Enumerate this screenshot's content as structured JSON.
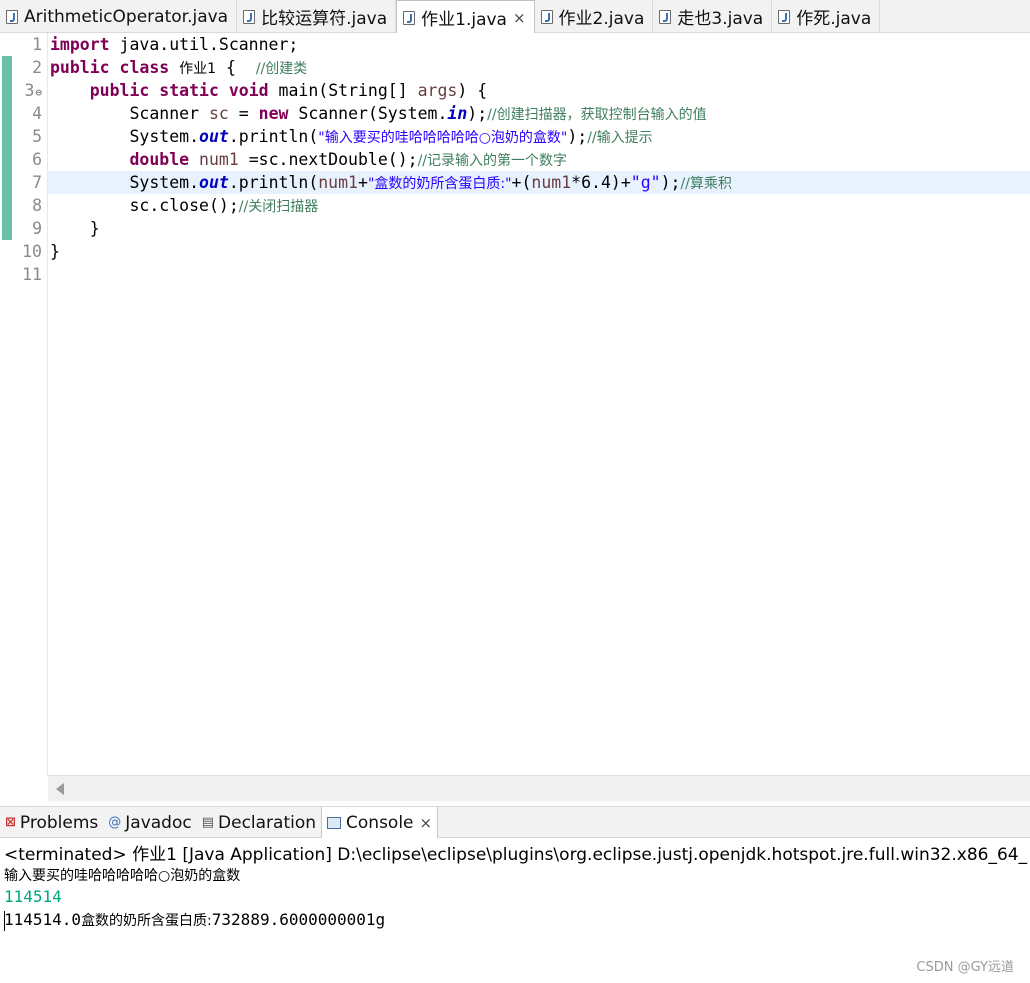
{
  "editor_tabs": [
    {
      "label": "ArithmeticOperator.java",
      "active": false
    },
    {
      "label": "比较运算符.java",
      "active": false
    },
    {
      "label": "作业1.java",
      "active": true
    },
    {
      "label": "作业2.java",
      "active": false
    },
    {
      "label": "走也3.java",
      "active": false
    },
    {
      "label": "作死.java",
      "active": false
    }
  ],
  "close_glyph": "×",
  "line_numbers": [
    "1",
    "2",
    "3",
    "4",
    "5",
    "6",
    "7",
    "8",
    "9",
    "10",
    "11"
  ],
  "code": {
    "l1": {
      "kw": "import",
      "rest": " java.util.Scanner;"
    },
    "l2": {
      "kw1": "public",
      "kw2": "class",
      "name": "作业1",
      "brace": " {  ",
      "comment": "//创建类"
    },
    "l3": {
      "kw1": "public",
      "kw2": "static",
      "kw3": "void",
      "rest": " main(String[] ",
      "args": "args",
      "end": ") {"
    },
    "l4": {
      "type": "Scanner ",
      "var": "sc",
      "eq": " = ",
      "kw": "new",
      "ctor": " Scanner(System.",
      "field": "in",
      "end": ");",
      "comment": "//创建扫描器，获取控制台输入的值"
    },
    "l5": {
      "pre": "System.",
      "field": "out",
      "call": ".println(",
      "str": "\"输入要买的哇哈哈哈哈哈○泡奶的盒数\"",
      "end": ");",
      "comment": "//输入提示"
    },
    "l6": {
      "kw": "double",
      "var": " num1 ",
      "rest": "=sc.nextDouble();",
      "comment": "//记录输入的第一个数字"
    },
    "l7": {
      "pre": "System.",
      "field": "out",
      "call": ".println(",
      "var1": "num1",
      "plus1": "+",
      "str1": "\"盒数的奶所含蛋白质:\"",
      "mid": "+(",
      "var2": "num1",
      "mul": "*6.4)+",
      "str2": "\"g\"",
      "end": ");",
      "comment": "//算乘积"
    },
    "l8": {
      "rest": "sc.close();",
      "comment": "//关闭扫描器"
    },
    "l9": {
      "rest": "}"
    },
    "l10": {
      "rest": "}"
    }
  },
  "view_tabs": [
    {
      "label": "Problems",
      "icon": "problems-icon"
    },
    {
      "label": "Javadoc",
      "icon": "javadoc-icon"
    },
    {
      "label": "Declaration",
      "icon": "declaration-icon"
    },
    {
      "label": "Console",
      "icon": "console-icon",
      "active": true
    }
  ],
  "console": {
    "status": "<terminated> 作业1 [Java Application] D:\\eclipse\\eclipse\\plugins\\org.eclipse.justj.openjdk.hotspot.jre.full.win32.x86_64_",
    "prompt_output": "输入要买的哇哈哈哈哈哈○泡奶的盒数",
    "user_input": "114514",
    "result_number": "114514.0",
    "result_text": "盒数的奶所含蛋白质:",
    "result_value": "732889.6000000001g"
  },
  "watermark": "CSDN @GY远道",
  "colors": {
    "keyword": "#7f0055",
    "string": "#2a00ff",
    "comment": "#3f7f5f",
    "field": "#0000c0",
    "console_input": "#00a67e",
    "line_highlight": "#e8f2fe"
  }
}
